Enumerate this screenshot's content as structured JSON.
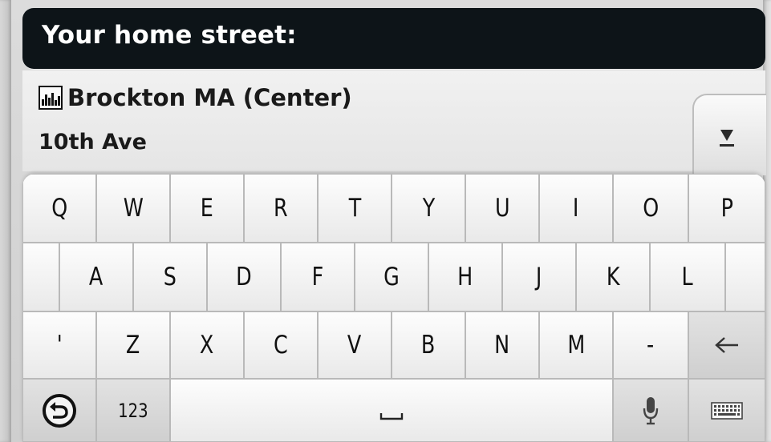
{
  "header": {
    "title": "Your home street:"
  },
  "results": {
    "city_icon": "city-icon",
    "city": "Brockton MA (Center)",
    "street": "10th Ave",
    "dropdown_icon": "chevron-down-icon"
  },
  "keyboard": {
    "row1": [
      "Q",
      "W",
      "E",
      "R",
      "T",
      "Y",
      "U",
      "I",
      "O",
      "P"
    ],
    "row2": [
      "A",
      "S",
      "D",
      "F",
      "G",
      "H",
      "J",
      "K",
      "L"
    ],
    "row3": [
      "'",
      "Z",
      "X",
      "C",
      "V",
      "B",
      "N",
      "M",
      "-"
    ],
    "backspace_icon": "backspace-arrow-icon",
    "back_icon": "back-circle-icon",
    "numbers_label": "123",
    "space_icon": "space-bar-icon",
    "mic_icon": "microphone-icon",
    "layout_icon": "keyboard-icon"
  }
}
